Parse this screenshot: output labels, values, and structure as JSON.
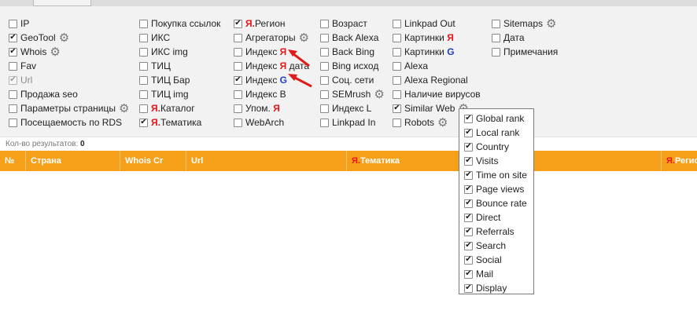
{
  "columns": [
    [
      {
        "label": "IP",
        "checked": false
      },
      {
        "label": "GeoTool",
        "checked": true,
        "gear": true
      },
      {
        "label": "Whois",
        "checked": true,
        "gear": true
      },
      {
        "label": "Fav",
        "checked": false
      },
      {
        "label": "Url",
        "checked": true,
        "disabled": true
      },
      {
        "label": "Продажа seo",
        "checked": false
      },
      {
        "label": "Параметры страницы",
        "checked": false,
        "gear": true
      },
      {
        "label": "Посещаемость по RDS",
        "checked": false
      }
    ],
    [
      {
        "label": "Покупка ссылок",
        "checked": false
      },
      {
        "label": "ИКС",
        "checked": false
      },
      {
        "label": "ИКС img",
        "checked": false
      },
      {
        "label": "ТИЦ",
        "checked": false
      },
      {
        "label": "ТИЦ Бар",
        "checked": false
      },
      {
        "label": "ТИЦ img",
        "checked": false
      },
      {
        "ya": "Я.",
        "label": "Каталог",
        "checked": false
      },
      {
        "ya": "Я.",
        "label": "Тематика",
        "checked": true
      }
    ],
    [
      {
        "ya": "Я.",
        "label": "Регион",
        "checked": true
      },
      {
        "label": "Агрегаторы",
        "checked": false,
        "gear": true
      },
      {
        "label": "Индекс ",
        "ya2": "Я",
        "checked": false
      },
      {
        "label": "Индекс ",
        "ya2": "Я",
        "suffix": " дата",
        "checked": false
      },
      {
        "label": "Индекс ",
        "gg": "G",
        "checked": true
      },
      {
        "label": "Индекс B",
        "checked": false
      },
      {
        "label": "Упом. ",
        "ya2": "Я",
        "checked": false
      },
      {
        "label": "WebArch",
        "checked": false
      }
    ],
    [
      {
        "label": "Возраст",
        "checked": false
      },
      {
        "label": "Back Alexa",
        "checked": false
      },
      {
        "label": "Back Bing",
        "checked": false
      },
      {
        "label": "Bing исход",
        "checked": false
      },
      {
        "label": "Соц. сети",
        "checked": false
      },
      {
        "label": "SEMrush",
        "checked": false,
        "gear": true
      },
      {
        "label": "Индекс L",
        "checked": false
      },
      {
        "label": "Linkpad In",
        "checked": false
      }
    ],
    [
      {
        "label": "Linkpad Out",
        "checked": false
      },
      {
        "label": "Картинки ",
        "ya2": "Я",
        "checked": false
      },
      {
        "label": "Картинки ",
        "gg": "G",
        "checked": false
      },
      {
        "label": "Alexa",
        "checked": false
      },
      {
        "label": "Alexa Regional",
        "checked": false
      },
      {
        "label": "Наличие вирусов",
        "checked": false
      },
      {
        "label": "Similar Web",
        "checked": true,
        "gear": true
      },
      {
        "label": "Robots",
        "checked": false,
        "gear": true
      }
    ],
    [
      {
        "label": "Sitemaps",
        "checked": false,
        "gear": true
      },
      {
        "label": "Дата",
        "checked": false
      },
      {
        "label": "Примечания",
        "checked": false
      }
    ]
  ],
  "results": {
    "label": "Кол-во результатов:",
    "count": "0"
  },
  "table_headers": [
    {
      "label": "№"
    },
    {
      "label": "Страна"
    },
    {
      "label": "Whois Cr"
    },
    {
      "label": "Url"
    },
    {
      "ya": "Я.",
      "label": "Тематика"
    },
    {
      "ya": "Я.",
      "label": "Регион"
    }
  ],
  "similarweb_options": [
    {
      "label": "Global rank",
      "checked": true
    },
    {
      "label": "Local rank",
      "checked": true
    },
    {
      "label": "Country",
      "checked": true
    },
    {
      "label": "Visits",
      "checked": true
    },
    {
      "label": "Time on site",
      "checked": true
    },
    {
      "label": "Page views",
      "checked": true
    },
    {
      "label": "Bounce rate",
      "checked": true
    },
    {
      "label": "Direct",
      "checked": true
    },
    {
      "label": "Referrals",
      "checked": true
    },
    {
      "label": "Search",
      "checked": true
    },
    {
      "label": "Social",
      "checked": true
    },
    {
      "label": "Mail",
      "checked": true
    },
    {
      "label": "Display",
      "checked": true
    }
  ],
  "colors": {
    "header_bg": "#f6a01a",
    "yandex_red": "#e4171b",
    "google_blue": "#1a3fc4",
    "arrow": "#e01b1b"
  },
  "icons": {
    "gear": "gear-icon",
    "arrow": "arrow-icon"
  }
}
